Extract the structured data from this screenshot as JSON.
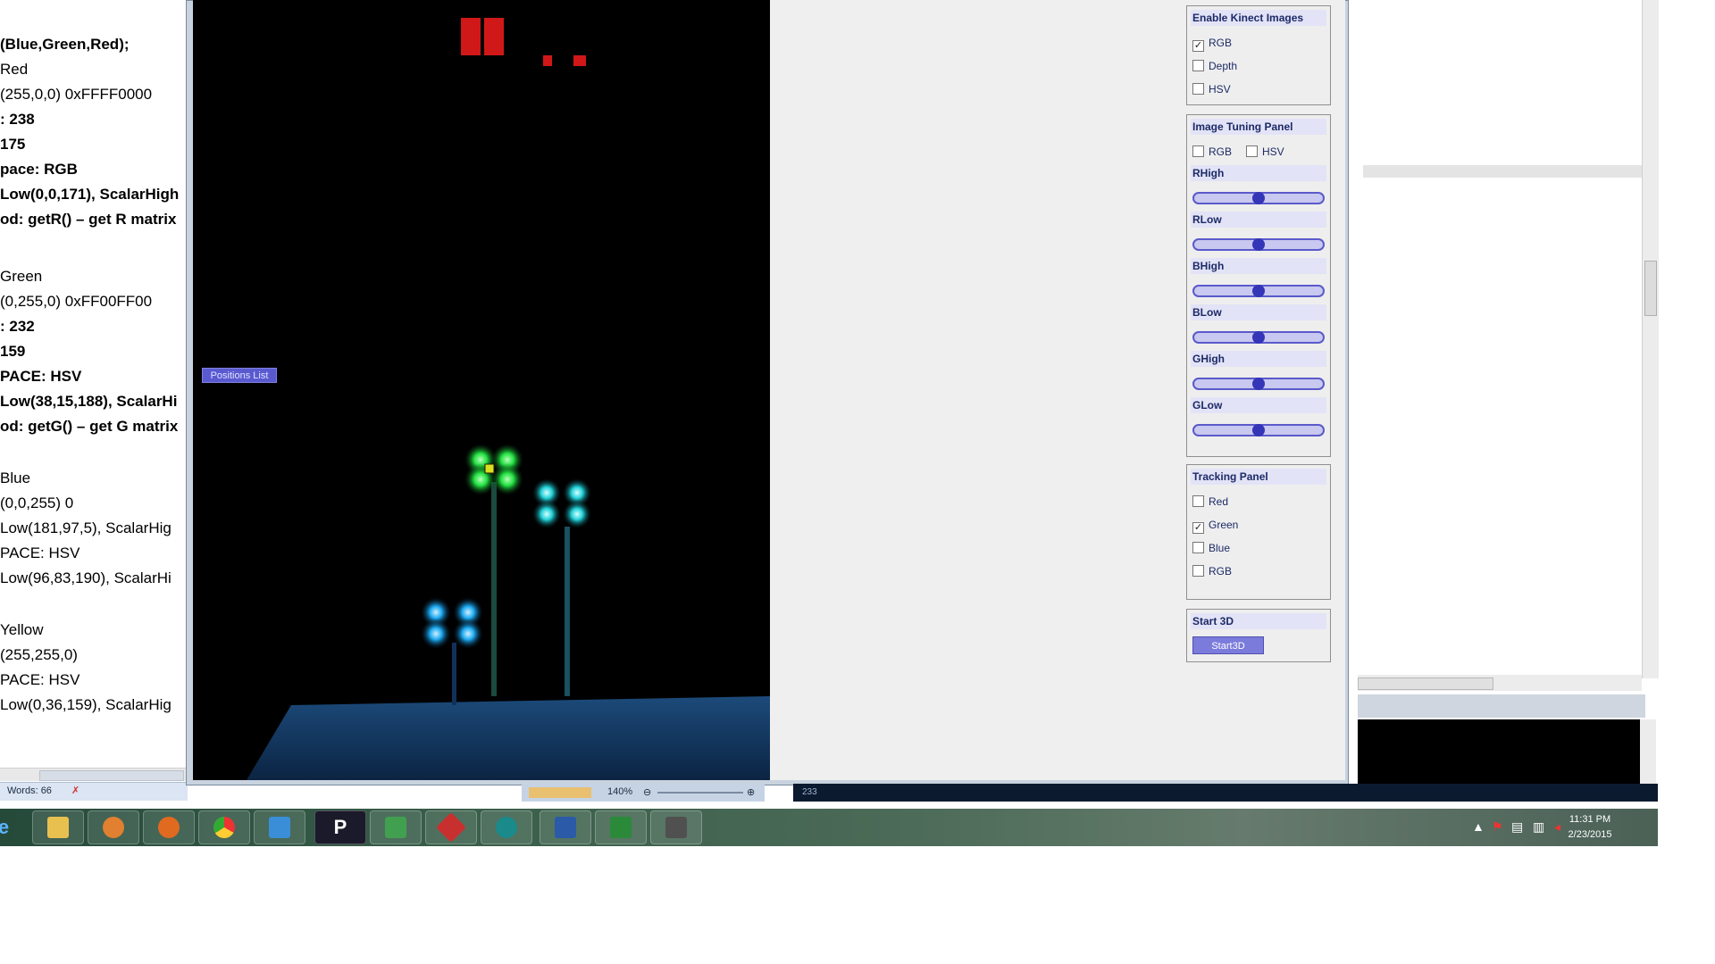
{
  "word": {
    "lines": [
      {
        "text": "(Blue,Green,Red);",
        "bold": true
      },
      {
        "text": " Red",
        "bold": false
      },
      {
        "text": " (255,0,0)  0xFFFF0000",
        "bold": false
      },
      {
        "text": ": 238",
        "bold": true
      },
      {
        "text": " 175",
        "bold": true
      },
      {
        "text": "pace: RGB",
        "bold": true
      },
      {
        "text": "Low(0,0,171),  ScalarHigh",
        "bold": true
      },
      {
        "text": "od: getR() – get R matrix",
        "bold": true
      },
      {
        "text": " Green",
        "bold": false
      },
      {
        "text": " (0,255,0)  0xFF00FF00",
        "bold": false
      },
      {
        "text": ": 232",
        "bold": true
      },
      {
        "text": " 159",
        "bold": true
      },
      {
        "text": "PACE: HSV",
        "bold": true
      },
      {
        "text": "Low(38,15,188),  ScalarHi",
        "bold": true
      },
      {
        "text": "od: getG() – get G matrix",
        "bold": true
      },
      {
        "text": " Blue",
        "bold": false
      },
      {
        "text": " (0,0,255)  0",
        "bold": false
      },
      {
        "text": "Low(181,97,5),  ScalarHig",
        "bold": false
      },
      {
        "text": "PACE: HSV",
        "bold": false
      },
      {
        "text": "Low(96,83,190),  ScalarHi",
        "bold": false
      },
      {
        "text": " Yellow",
        "bold": false
      },
      {
        "text": " (255,255,0)",
        "bold": false
      },
      {
        "text": "PACE: HSV",
        "bold": false
      },
      {
        "text": "Low(0,36,159),  ScalarHig",
        "bold": false
      }
    ],
    "status_words": "Words: 66",
    "zoom": "140%"
  },
  "app": {
    "positions_list": "Positions List",
    "panels": {
      "enable": {
        "title": "Enable Kinect Images",
        "items": [
          {
            "label": "RGB",
            "checked": true
          },
          {
            "label": "Depth",
            "checked": false
          },
          {
            "label": "HSV",
            "checked": false
          }
        ]
      },
      "tuning": {
        "title": "Image Tuning Panel",
        "checks": [
          {
            "label": "RGB",
            "checked": false
          },
          {
            "label": "HSV",
            "checked": false
          }
        ],
        "sliders": [
          {
            "label": "RHigh",
            "value": 0.5
          },
          {
            "label": "RLow",
            "value": 0.5
          },
          {
            "label": "BHigh",
            "value": 0.5
          },
          {
            "label": "BLow",
            "value": 0.5
          },
          {
            "label": "GHigh",
            "value": 0.5
          },
          {
            "label": "GLow",
            "value": 0.5
          }
        ]
      },
      "tracking": {
        "title": "Tracking Panel",
        "items": [
          {
            "label": "Red",
            "checked": false
          },
          {
            "label": "Green",
            "checked": true
          },
          {
            "label": "Blue",
            "checked": false
          },
          {
            "label": "RGB",
            "checked": false
          }
        ]
      },
      "start3d": {
        "title": "Start 3D",
        "button": "Start3D"
      }
    }
  },
  "console_status": "233",
  "taskbar": {
    "apps": [
      "ie-icon",
      "explorer-icon",
      "media-player-icon",
      "firefox-icon",
      "chrome-icon",
      "window-icon",
      "p-icon",
      "green-app-icon",
      "red-app-icon",
      "arduino-icon",
      "word-icon",
      "excel-icon",
      "dark-app-icon"
    ],
    "p_letter": "P",
    "clock_time": "11:31 PM",
    "clock_date": "2/23/2015"
  },
  "colors": {
    "accent": "#7b7bdc",
    "panel_title_bg": "#e3e3f7",
    "panel_text": "#1c2a66",
    "slider_knob": "#3535b8"
  }
}
